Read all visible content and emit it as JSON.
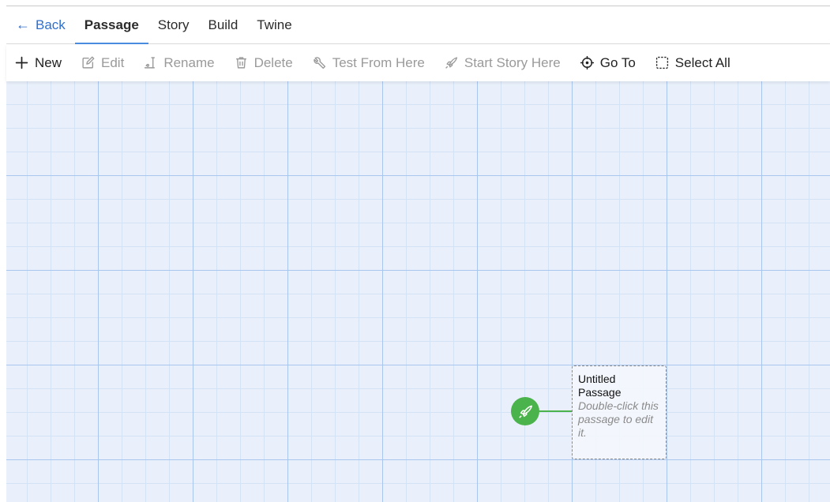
{
  "tabs": {
    "back_label": "Back",
    "items": [
      {
        "label": "Passage",
        "active": true
      },
      {
        "label": "Story"
      },
      {
        "label": "Build"
      },
      {
        "label": "Twine"
      }
    ]
  },
  "toolbar": {
    "new_label": "New",
    "edit_label": "Edit",
    "rename_label": "Rename",
    "delete_label": "Delete",
    "test_from_here_label": "Test From Here",
    "start_story_here_label": "Start Story Here",
    "go_to_label": "Go To",
    "select_all_label": "Select All"
  },
  "icons": {
    "back": "arrow-left-icon",
    "new": "plus-icon",
    "edit": "pencil-icon",
    "rename": "rename-icon",
    "delete": "trash-icon",
    "test": "tool-icon",
    "start": "rocket-icon",
    "goto": "crosshair-icon",
    "select_all": "marquee-icon"
  },
  "canvas": {
    "passage": {
      "title": "Untitled Passage",
      "excerpt": "Double-click this passage to edit it."
    }
  },
  "colors": {
    "accent": "#4a8de0",
    "link": "#2f6fd0",
    "start_badge": "#4bb34b",
    "canvas_bg": "#e9f0fb",
    "grid_major": "#a9c7ee",
    "grid_minor": "#d4e2f5",
    "disabled_text": "#9a9a9a"
  }
}
